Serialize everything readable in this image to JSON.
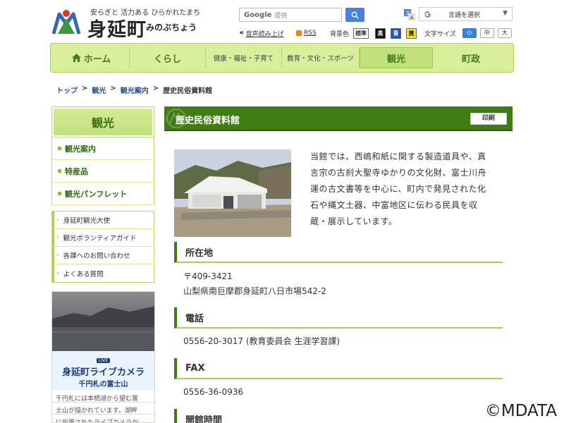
{
  "header": {
    "tagline": "安らぎと 活力ある ひらかれたまち",
    "town_name": "身延町",
    "town_kana": "みのぶちょう",
    "search_brand": "Google",
    "search_placeholder": "提供",
    "translate_label": "言語を選択",
    "read_aloud": "音声読み上げ",
    "rss": "RSS",
    "bg_color_label": "背景色",
    "bg_options": [
      "標準",
      "黒",
      "青",
      "黄"
    ],
    "font_size_label": "文字サイズ",
    "font_sizes": [
      "小",
      "中",
      "大"
    ]
  },
  "colors": {
    "nav_bg": "#d9ef9c",
    "nav_text": "#4a7a1a",
    "title_bar": "#3f7d14",
    "link": "#2a4e8f",
    "accent_blue": "#4a80e0"
  },
  "gnav": {
    "items": [
      {
        "label": "ホーム",
        "icon": "home-icon"
      },
      {
        "label": "くらし"
      },
      {
        "label": "健康・福祉・子育て"
      },
      {
        "label": "教育・文化・スポーツ"
      },
      {
        "label": "観光"
      },
      {
        "label": "町政"
      }
    ]
  },
  "breadcrumb": {
    "items": [
      "トップ",
      "観光",
      "観光案内"
    ],
    "separator": ">",
    "current": "歴史民俗資料館"
  },
  "sidebar": {
    "title": "観光",
    "menu": [
      "観光案内",
      "特産品",
      "観光パンフレット"
    ],
    "sub_links": [
      "身延町観光大使",
      "観光ボランティアガイド",
      "各課へのお問い合わせ",
      "よくある質問"
    ],
    "livecam": {
      "badge": "LIVE",
      "title": "身延町ライブカメラ",
      "subtitle": "千円札の富士山",
      "desc_lines": [
        "千円札には本栖湖から望む富",
        "士山が描かれています。湖畔",
        "に設置されたライブカメラか"
      ]
    }
  },
  "main": {
    "page_title": "歴史民俗資料館",
    "print_label": "印刷",
    "intro_lines": [
      "当館では、西嶋和紙に関する製造道具や、真",
      "言宗の古刹大聖寺ゆかりの文化財、富士川舟",
      "運の古文書等を中心に、町内で発見された化",
      "石や縄文土器、中富地区に伝わる民具を収",
      "蔵・展示しています。"
    ],
    "sections": [
      {
        "heading": "所在地",
        "lines": [
          "〒409-3421",
          "山梨県南巨摩郡身延町八日市場542-2"
        ]
      },
      {
        "heading": "電話",
        "lines": [
          "0556-20-3017 (教育委員会 生涯学習課)"
        ]
      },
      {
        "heading": "FAX",
        "lines": [
          "0556-36-0936"
        ]
      },
      {
        "heading": "開館時間",
        "lines": []
      }
    ]
  },
  "watermark": "©MDATA"
}
